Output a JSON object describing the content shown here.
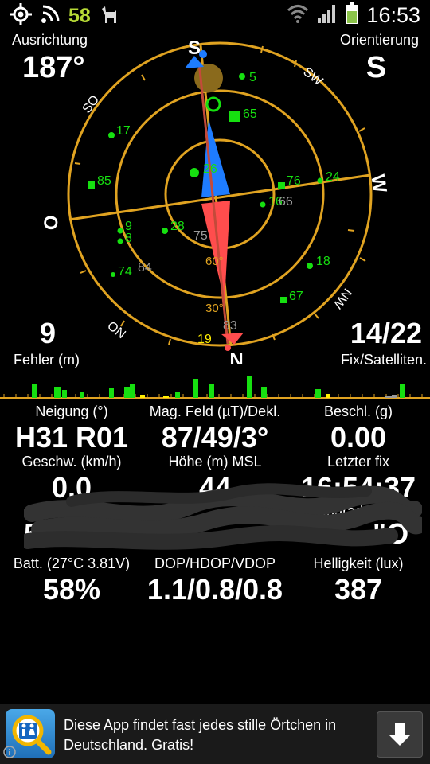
{
  "status_bar": {
    "gps_icon": "gps-target-icon",
    "signal_icon": "signal-waves-icon",
    "notification_count": "58",
    "app_icon": "llama-icon",
    "wifi_icon": "wifi-icon",
    "cell_icon": "cell-signal-icon",
    "battery_icon": "battery-icon",
    "time": "16:53"
  },
  "header": {
    "left_label": "Ausrichtung",
    "left_value": "187°",
    "right_label": "Orientierung",
    "right_value": "S"
  },
  "compass": {
    "directions": {
      "top": "S",
      "right": "W",
      "left": "O",
      "bottom": "N",
      "sw": "SW",
      "nw": "NW",
      "no": "NO",
      "so": "SO"
    },
    "elevation_labels": [
      "60°",
      "30°"
    ],
    "satellites": [
      {
        "id": "5"
      },
      {
        "id": "65"
      },
      {
        "id": "17"
      },
      {
        "id": "26"
      },
      {
        "id": "85"
      },
      {
        "id": "76"
      },
      {
        "id": "24"
      },
      {
        "id": "16"
      },
      {
        "id": "66"
      },
      {
        "id": "9"
      },
      {
        "id": "8"
      },
      {
        "id": "28"
      },
      {
        "id": "75"
      },
      {
        "id": "18"
      },
      {
        "id": "74"
      },
      {
        "id": "84"
      },
      {
        "id": "67"
      },
      {
        "id": "83"
      },
      {
        "id": "19"
      }
    ],
    "colors": {
      "ring": "#e0a321",
      "sat_used": "#16e010",
      "sat_unused": "#9a9a9a",
      "sun": "#8a6a1c",
      "needle_blue": "#1e7cff",
      "needle_red": "#ff4d4d"
    }
  },
  "stats_top": {
    "error_value": "9",
    "error_label": "Fehler (m)",
    "fix_value": "14/22",
    "fix_label": "Fix/Satelliten."
  },
  "grid": {
    "row1": [
      {
        "label": "Neigung (°)",
        "value": "H31 R01"
      },
      {
        "label": "Mag. Feld (µT)/Dekl.",
        "value": "87/49/3°"
      },
      {
        "label": "Beschl. (g)",
        "value": "0.00"
      }
    ],
    "row2": [
      {
        "label": "Geschw. (km/h)",
        "value": "0.0"
      },
      {
        "label": "Höhe (m) MSL",
        "value": "44"
      },
      {
        "label": "Letzter fix",
        "value": "16:54:37"
      }
    ],
    "row3_fragments": {
      "left": "Breiten",
      "right": "ängengrad",
      "left_value": "5",
      "right_value": "\"O"
    },
    "row4": [
      {
        "label": "Batt. (27°C 3.81V)",
        "value": "58%"
      },
      {
        "label": "DOP/HDOP/VDOP",
        "value": "1.1/0.8/0.8"
      },
      {
        "label": "Helligkeit (lux)",
        "value": "387"
      }
    ]
  },
  "ad": {
    "icon": "toilet-search-icon",
    "text_line1": "Diese App findet fast jedes stille Örtchen in",
    "text_line2": "Deutschland. Gratis!",
    "download_icon": "download-arrow-icon",
    "info_icon": "info-icon"
  }
}
